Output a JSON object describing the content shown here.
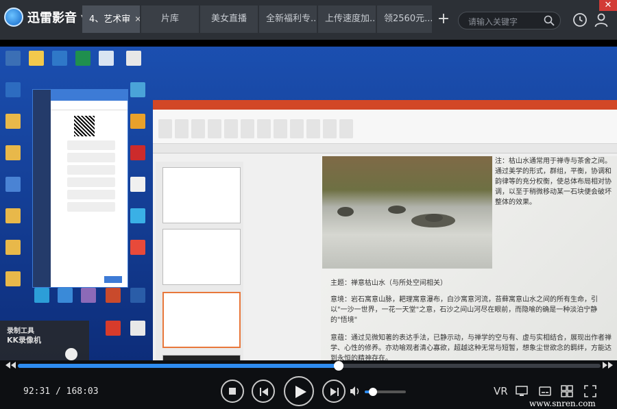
{
  "app": {
    "name": "迅雷影音"
  },
  "tabs": [
    {
      "label": "4、艺术审",
      "active": true
    },
    {
      "label": "片库"
    },
    {
      "label": "美女直播"
    },
    {
      "label": "全新福利专..."
    },
    {
      "label": "上传速度加..."
    },
    {
      "label": "领2560元..."
    }
  ],
  "search": {
    "placeholder": "请输入关键字"
  },
  "recorder": {
    "title": "录制工具",
    "subtitle": "KK录像机"
  },
  "slide": {
    "note": "注：枯山水通常用于禅寺与茶舍之间。通过美学的形式，群组，平衡，协调和韵律等的充分权衡，使总体布局相对协调，以至于稍微移动某一石块便会破坏整体的效果。",
    "theme": "主题：禅意枯山水（与所处空间相关）",
    "meaning": "意境：岩石寓意山脉，耙理寓意瀑布，白沙寓意河流，苔藓寓意山水之间的所有生命，引以\"一沙一世界，一花一天堂\"之意，石沙之间山河尽在眼前，而隐喻的确是一种淡泊宁静的\"悟境\"",
    "essence": "意蕴：通过见微知著的表达手法，已静示动，与禅学的空与有、虚与实相结合，展现出作者禅学、心性的修养。亦劝喻观者清心寡欲，超越这种无常与短暂，想象尘世欲念的羁绊，方能达到永恒的精神存在。"
  },
  "player": {
    "current_time": "92:31",
    "total_time": "168:03",
    "progress": 0.551,
    "volume": 0.2,
    "vr_label": "VR"
  },
  "watermark": "www.snren.com"
}
